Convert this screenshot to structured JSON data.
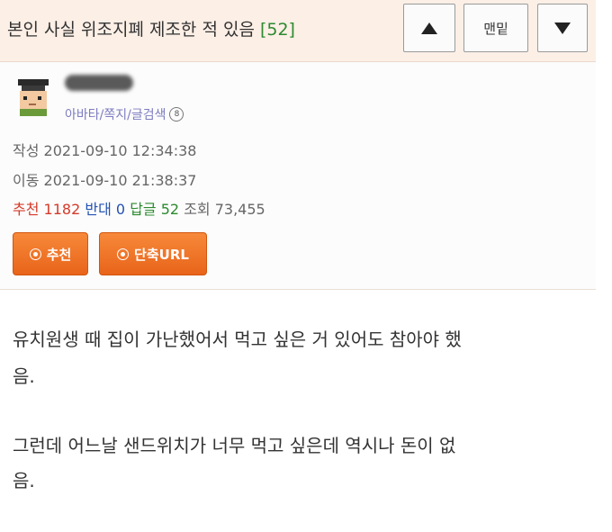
{
  "header": {
    "title": "본인 사실 위조지폐 제조한 적 있음",
    "comment_count": "[52]",
    "bottom_label": "맨밑"
  },
  "profile": {
    "links": "아바타/쪽지/글검색",
    "badge": "8",
    "written_label": "작성",
    "written_time": "2021-09-10 12:34:38",
    "moved_label": "이동",
    "moved_time": "2021-09-10 21:38:37",
    "recommend_label": "추천",
    "recommend_count": "1182",
    "oppose_label": "반대",
    "oppose_count": "0",
    "reply_label": "답글",
    "reply_count": "52",
    "views_label": "조회",
    "views_count": "73,455",
    "recommend_button": "추천",
    "shorturl_button": "단축URL"
  },
  "content": {
    "line1": "유치원생 때 집이 가난했어서 먹고 싶은 거 있어도 참아야 했",
    "line2": "음.",
    "line3": "그런데 어느날 샌드위치가 너무 먹고 싶은데 역시나 돈이 없",
    "line4": "음."
  },
  "colors": {
    "accent_orange": "#ee6f22",
    "header_bg": "#fcefe6",
    "recommend_red": "#d53a2a",
    "oppose_blue": "#2452b2",
    "reply_green": "#2c8a2f"
  },
  "icons": [
    "arrow-up-icon",
    "arrow-down-icon",
    "avatar-icon",
    "badge-icon",
    "circle-icon"
  ]
}
